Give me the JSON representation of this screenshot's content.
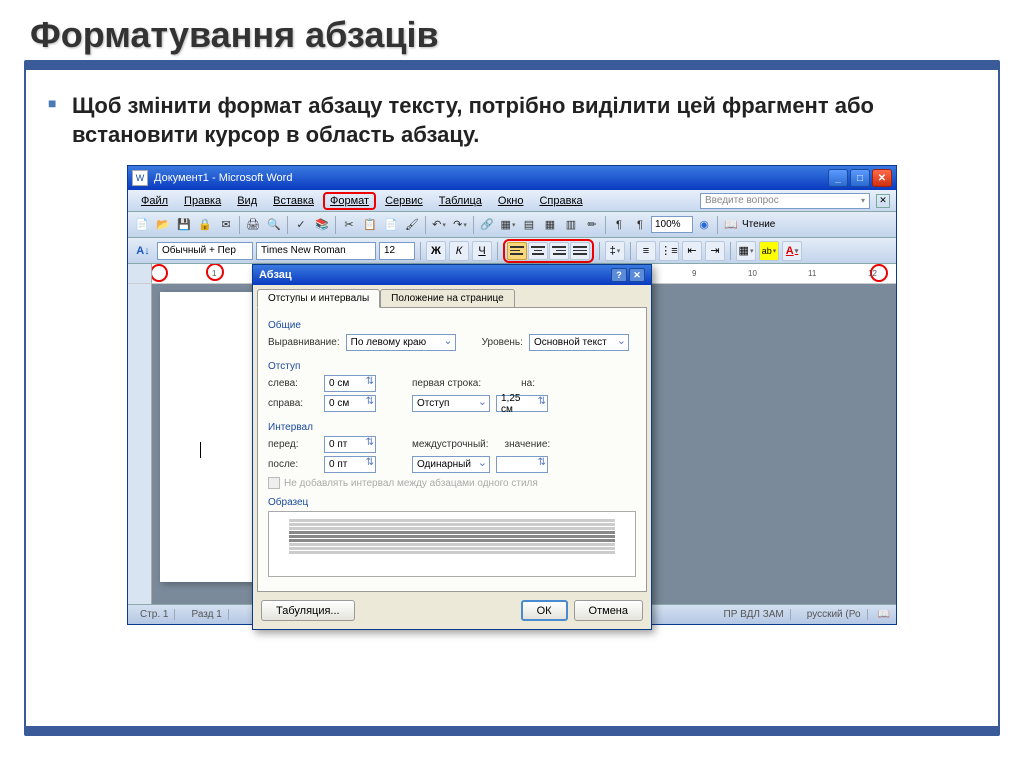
{
  "slide": {
    "title": "Форматування абзаців",
    "bullet": "Щоб змінити формат абзацу тексту, потрібно виділити цей фрагмент або встановити курсор в область абзацу."
  },
  "word": {
    "title": "Документ1 - Microsoft Word",
    "menu": {
      "file": "Файл",
      "edit": "Правка",
      "view": "Вид",
      "insert": "Вставка",
      "format": "Формат",
      "service": "Сервис",
      "table": "Таблица",
      "window": "Окно",
      "help": "Справка"
    },
    "helpPlaceholder": "Введите вопрос",
    "zoom": "100%",
    "reading": "Чтение",
    "styleBox": "Обычный + Пер",
    "fontBox": "Times New Roman",
    "sizeBox": "12",
    "bold": "Ж",
    "italic": "К",
    "underline": "Ч",
    "status": {
      "page": "Стр. 1",
      "sect": "Разд 1",
      "modes": "ПР   ВДЛ   ЗАМ",
      "lang": "русский (Ро"
    }
  },
  "dialog": {
    "title": "Абзац",
    "tab1": "Отступы и интервалы",
    "tab2": "Положение на странице",
    "sec_general": "Общие",
    "align_label": "Выравнивание:",
    "align_value": "По левому краю",
    "level_label": "Уровень:",
    "level_value": "Основной текст",
    "sec_indent": "Отступ",
    "left_label": "слева:",
    "left_value": "0 см",
    "right_label": "справа:",
    "right_value": "0 см",
    "first_label": "первая строка:",
    "first_value": "Отступ",
    "on_label": "на:",
    "on_value": "1,25 см",
    "sec_interval": "Интервал",
    "before_label": "перед:",
    "before_value": "0 пт",
    "after_label": "после:",
    "after_value": "0 пт",
    "spacing_label": "междустрочный:",
    "spacing_value": "Одинарный",
    "val_label": "значение:",
    "val_value": "",
    "same_style": "Не добавлять интервал между абзацами одного стиля",
    "sample": "Образец",
    "tabulation": "Табуляция...",
    "ok": "ОК",
    "cancel": "Отмена"
  }
}
